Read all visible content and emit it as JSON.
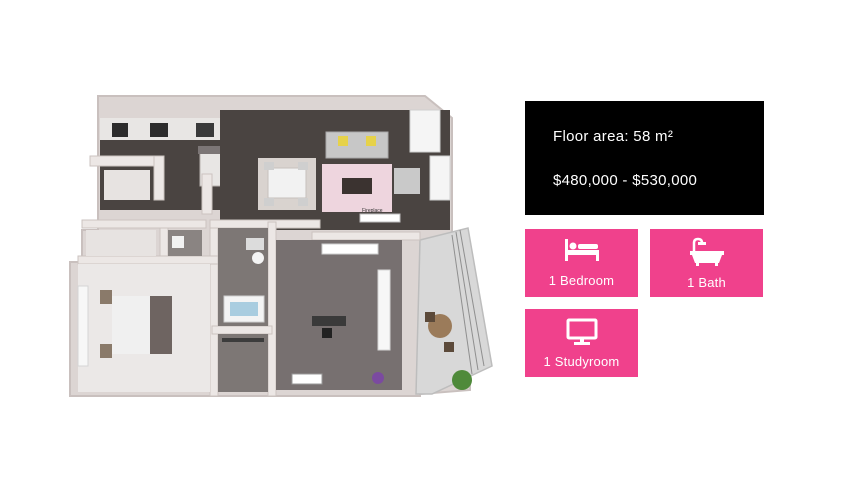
{
  "floorplan": {
    "fireplace_label": "Fireplace"
  },
  "info": {
    "floor_area": "Floor area: 58 m²",
    "price_range": "$480,000 - $530,000"
  },
  "features": [
    {
      "icon": "bed-icon",
      "label": "1 Bedroom"
    },
    {
      "icon": "bathtub-icon",
      "label": "1 Bath"
    },
    {
      "icon": "monitor-icon",
      "label": "1 Studyroom"
    }
  ],
  "colors": {
    "info_box": "#000000",
    "tile_accent": "#f0418c",
    "text_light": "#ffffff"
  }
}
